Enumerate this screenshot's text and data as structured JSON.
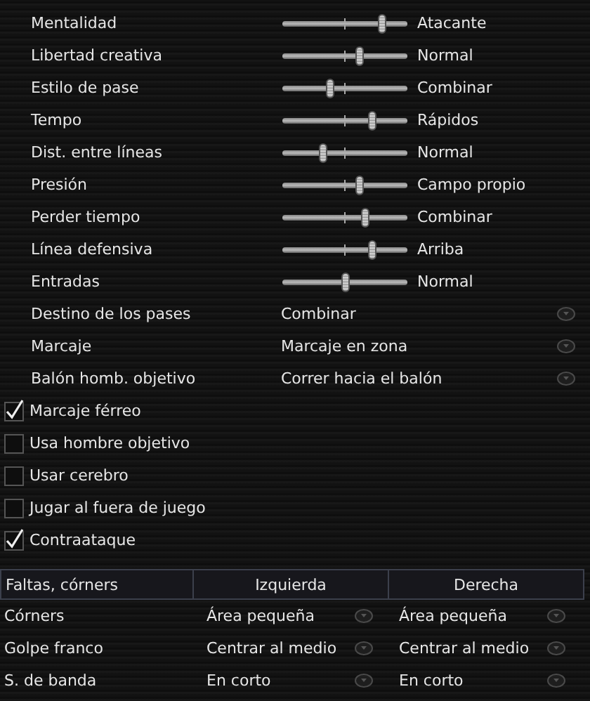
{
  "sliders": [
    {
      "label": "Mentalidad",
      "level": 0.8,
      "reading": "Atacante"
    },
    {
      "label": "Libertad creativa",
      "level": 0.62,
      "reading": "Normal"
    },
    {
      "label": "Estilo de pase",
      "level": 0.38,
      "reading": "Combinar"
    },
    {
      "label": "Tempo",
      "level": 0.72,
      "reading": "Rápidos"
    },
    {
      "label": "Dist. entre líneas",
      "level": 0.33,
      "reading": "Normal"
    },
    {
      "label": "Presión",
      "level": 0.62,
      "reading": "Campo propio"
    },
    {
      "label": "Perder tiempo",
      "level": 0.66,
      "reading": "Combinar"
    },
    {
      "label": "Línea defensiva",
      "level": 0.72,
      "reading": "Arriba"
    },
    {
      "label": "Entradas",
      "level": 0.5,
      "reading": "Normal"
    }
  ],
  "selects": [
    {
      "label": "Destino de los pases",
      "value": "Combinar"
    },
    {
      "label": "Marcaje",
      "value": "Marcaje en zona"
    },
    {
      "label": "Balón homb. objetivo",
      "value": "Correr hacia el balón"
    }
  ],
  "options": [
    {
      "label": "Marcaje férreo",
      "checked": true
    },
    {
      "label": "Usa hombre objetivo",
      "checked": false
    },
    {
      "label": "Usar cerebro",
      "checked": false
    },
    {
      "label": "Jugar al fuera de juego",
      "checked": false
    },
    {
      "label": "Contraataque",
      "checked": true
    }
  ],
  "set_pieces": {
    "columns": [
      "Faltas, córners",
      "Izquierda",
      "Derecha"
    ],
    "rows": [
      {
        "label": "Córners",
        "left": "Área pequeña",
        "right": "Área pequeña"
      },
      {
        "label": "Golpe franco",
        "left": "Centrar al medio",
        "right": "Centrar al medio"
      },
      {
        "label": "S. de banda",
        "left": "En corto",
        "right": "En corto"
      }
    ]
  }
}
